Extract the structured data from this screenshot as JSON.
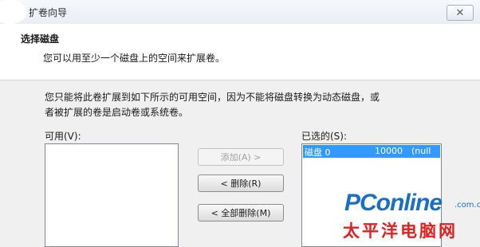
{
  "window": {
    "title": "扩卷向导"
  },
  "header": {
    "title": "选择磁盘",
    "subtitle": "您可以用至少一个磁盘上的空间来扩展卷。"
  },
  "description": {
    "line1": "您只能将此卷扩展到如下所示的可用空间，因为不能将磁盘转换为动态磁盘，或",
    "line2": "者被扩展的卷是启动卷或系统卷。"
  },
  "available": {
    "label": "可用(V):",
    "items": []
  },
  "buttons": {
    "add": "添加(A) >",
    "remove": "< 删除(R)",
    "remove_all": "< 全部删除(M)"
  },
  "selected": {
    "label": "已选的(S):",
    "items": [
      {
        "disk": "磁盘 0",
        "size": "10000",
        "free": "(null"
      }
    ]
  },
  "watermark": {
    "brand": "PConline",
    "domain": ".com.cn",
    "cn": "太平洋电脑网"
  },
  "colors": {
    "selection": "#3399ff",
    "brand_blue": "#1a6fc4",
    "brand_red": "#e02020"
  },
  "icons": {
    "close": "close-icon"
  }
}
